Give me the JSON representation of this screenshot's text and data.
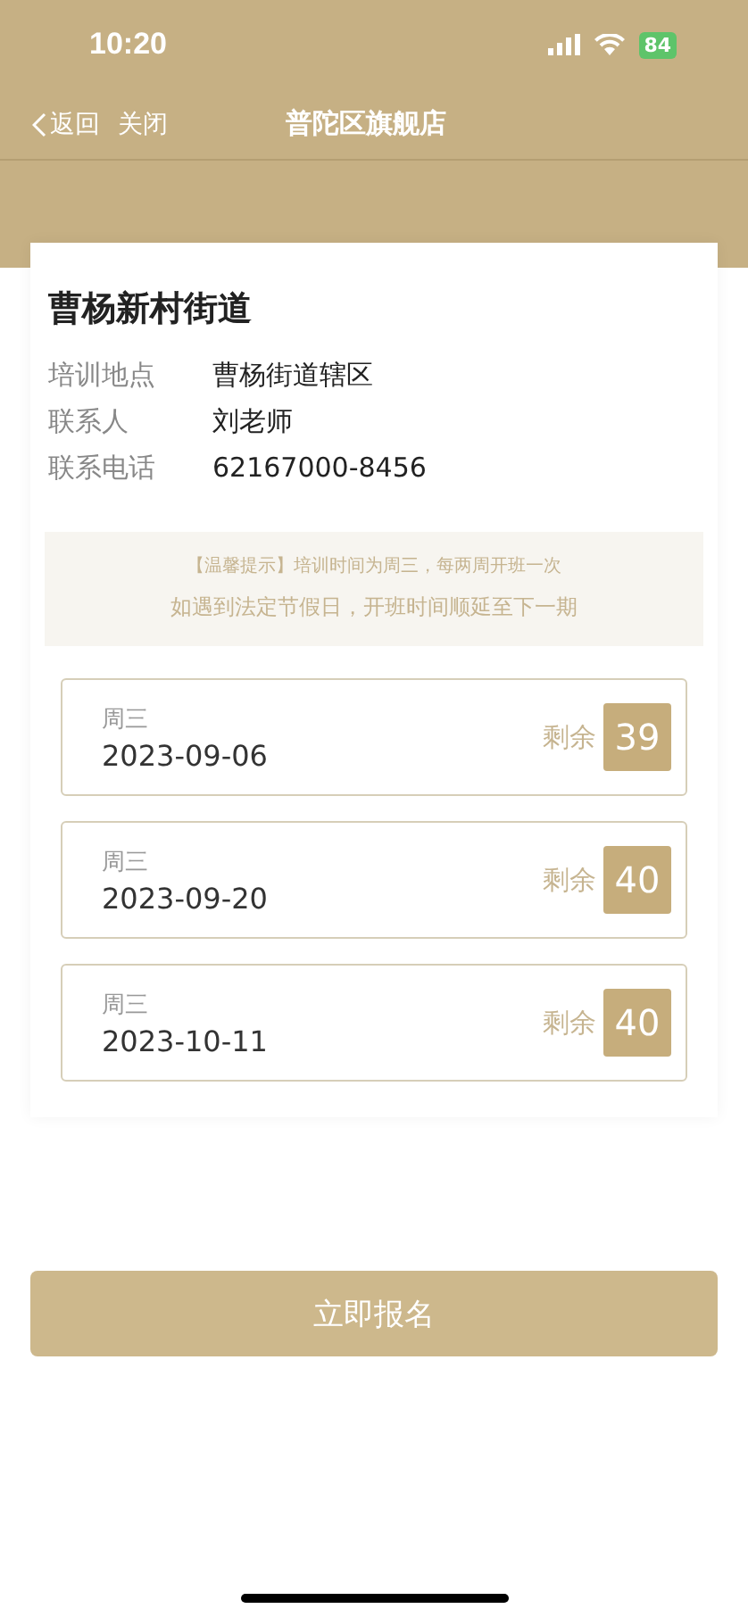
{
  "status_bar": {
    "time": "10:20",
    "battery": "84"
  },
  "nav": {
    "back": "返回",
    "close": "关闭",
    "title": "普陀区旗舰店"
  },
  "card": {
    "title": "曹杨新村街道",
    "details": [
      {
        "label": "培训地点",
        "value": "曹杨街道辖区"
      },
      {
        "label": "联系人",
        "value": "刘老师"
      },
      {
        "label": "联系电话",
        "value": "62167000-8456"
      }
    ],
    "notice": [
      "【温馨提示】培训时间为周三，每两周开班一次",
      "如遇到法定节假日，开班时间顺延至下一期"
    ],
    "sessions": [
      {
        "weekday": "周三",
        "date": "2023-09-06",
        "remaining_label": "剩余",
        "remaining": "39"
      },
      {
        "weekday": "周三",
        "date": "2023-09-20",
        "remaining_label": "剩余",
        "remaining": "40"
      },
      {
        "weekday": "周三",
        "date": "2023-10-11",
        "remaining_label": "剩余",
        "remaining": "40"
      }
    ]
  },
  "submit": {
    "label": "立即报名",
    "disabled": true
  }
}
